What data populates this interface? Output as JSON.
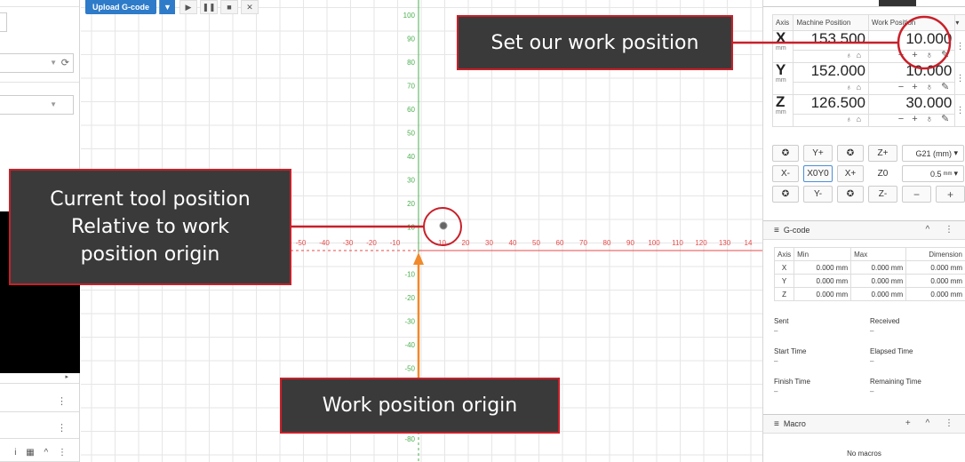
{
  "toolbar": {
    "upload_label": "Upload G-code",
    "upload_caret": "▼",
    "play_icon": "▶",
    "pause_icon": "❚❚",
    "stop_icon": "■",
    "close_icon": "✕"
  },
  "visualizer": {
    "x_ticks": [
      -50,
      -40,
      -30,
      -20,
      -10,
      10,
      20,
      30,
      40,
      50,
      60,
      70,
      80,
      90,
      100,
      110,
      120,
      130,
      14
    ],
    "y_ticks": [
      100,
      90,
      80,
      70,
      60,
      50,
      40,
      30,
      20,
      10,
      -10,
      -20,
      -30,
      -40,
      -50,
      -80
    ],
    "colors": {
      "x_axis": "#e84a4a",
      "y_axis": "#4caf50",
      "grid": "#e6e6e6",
      "annotation": "#c8202a",
      "origin_arrow": "#f08a2c"
    }
  },
  "axis_panel": {
    "headers": {
      "axis": "Axis",
      "machine": "Machine Position",
      "work": "Work Position"
    },
    "rows": [
      {
        "axis": "X",
        "unit": "mm",
        "machine": "153.500",
        "work": "10.000"
      },
      {
        "axis": "Y",
        "unit": "mm",
        "machine": "152.000",
        "work": "10.000"
      },
      {
        "axis": "Z",
        "unit": "mm",
        "machine": "126.500",
        "work": "30.000"
      }
    ]
  },
  "jog": {
    "y_plus": "Y+",
    "z_plus": "Z+",
    "x_minus": "X-",
    "x0y0": "X0Y0",
    "x_plus": "X+",
    "z0": "Z0",
    "y_minus": "Y-",
    "z_minus": "Z-",
    "units_select": "G21 (mm)",
    "step_value": "0.5",
    "step_unit": "mm"
  },
  "gcode": {
    "title": "G-code",
    "headers": {
      "axis": "Axis",
      "min": "Min",
      "max": "Max",
      "dimension": "Dimension"
    },
    "rows": [
      {
        "axis": "X",
        "min": "0.000 mm",
        "max": "0.000 mm",
        "dimension": "0.000 mm"
      },
      {
        "axis": "Y",
        "min": "0.000 mm",
        "max": "0.000 mm",
        "dimension": "0.000 mm"
      },
      {
        "axis": "Z",
        "min": "0.000 mm",
        "max": "0.000 mm",
        "dimension": "0.000 mm"
      }
    ],
    "sent_label": "Sent",
    "sent_value": "–",
    "received_label": "Received",
    "received_value": "–",
    "start_label": "Start Time",
    "start_value": "–",
    "elapsed_label": "Elapsed Time",
    "elapsed_value": "–",
    "finish_label": "Finish Time",
    "finish_value": "–",
    "remaining_label": "Remaining Time",
    "remaining_value": "–"
  },
  "macro": {
    "title": "Macro",
    "empty": "No macros"
  },
  "callouts": {
    "set_work_position": "Set our work position",
    "current_tool_line1": "Current tool position",
    "current_tool_line2": "Relative to work",
    "current_tool_line3": "position origin",
    "work_origin": "Work position origin"
  }
}
